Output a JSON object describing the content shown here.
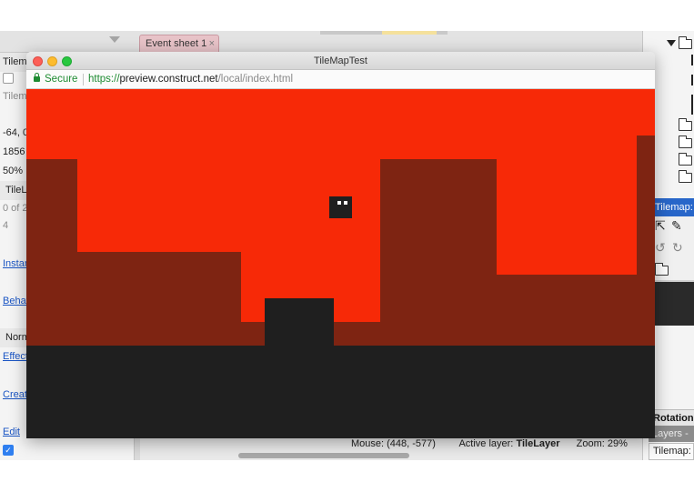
{
  "editor": {
    "left_panel": {
      "rows": [
        {
          "text": "Tilem",
          "style": "band"
        },
        {
          "text": "",
          "style": "checkbox"
        },
        {
          "text": "Tilem",
          "style": "grey"
        },
        {
          "text": "-64, 0",
          "style": "plain"
        },
        {
          "text": "1856",
          "style": "plain"
        },
        {
          "text": "50%",
          "style": "plain"
        },
        {
          "text": "TileL",
          "style": "band"
        },
        {
          "text": "0 of 2",
          "style": "grey"
        },
        {
          "text": "4",
          "style": "grey"
        },
        {
          "text": "Instan",
          "style": "link"
        },
        {
          "text": "Behav",
          "style": "link"
        },
        {
          "text": "Norm",
          "style": "band"
        },
        {
          "text": "Effect",
          "style": "link"
        },
        {
          "text": "Creat",
          "style": "link"
        },
        {
          "text": "Edit",
          "style": "link"
        }
      ]
    },
    "tab": {
      "label": "Event sheet 1",
      "close": "×"
    },
    "status_bar": {
      "mouse_label": "Mouse: (448, -577)",
      "active_layer_label": "Active layer:",
      "active_layer_value": "TileLayer",
      "zoom_label": "Zoom: 29%"
    },
    "right_panel": {
      "tilemap_header": "Tilemap: T",
      "rotation_label": "Rotation",
      "layers_tab": "Layers -",
      "tilemap_tab": "Tilemap:"
    }
  },
  "browser": {
    "window_title": "TileMapTest",
    "secure_label": "Secure",
    "url_scheme": "https://",
    "url_host": "preview.construct.net",
    "url_path": "/local/index.html"
  },
  "colors": {
    "sky": "#f72907",
    "terrain": "#7e2412",
    "floor": "#1f1f1f",
    "accent": "#2866c9"
  },
  "icons": [
    "lock-icon",
    "folder-icon",
    "arrow-cursor-icon",
    "pencil-icon",
    "rotate-ccw-icon",
    "rotate-cw-icon",
    "close-icon",
    "chevron-down-icon"
  ]
}
